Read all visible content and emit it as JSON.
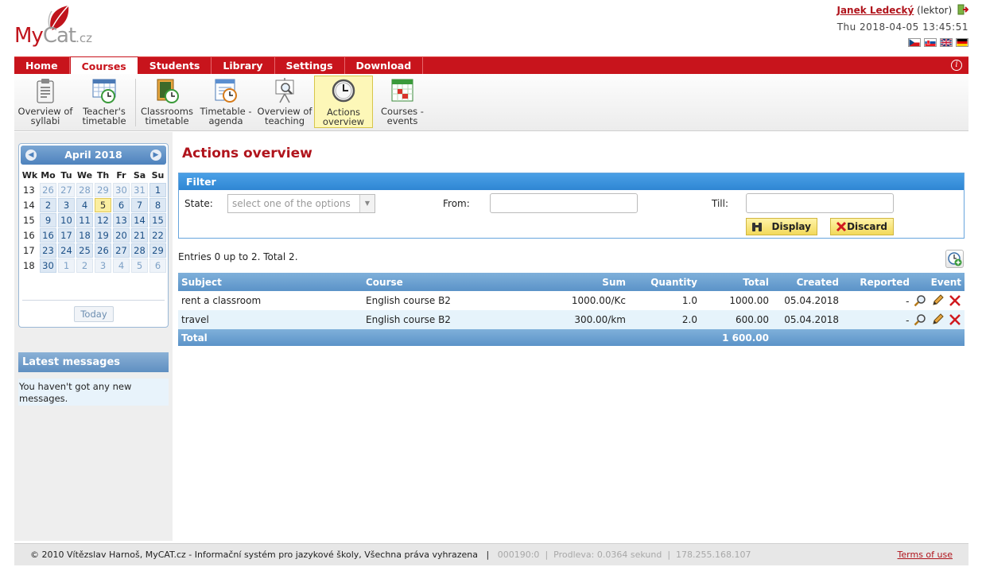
{
  "brand": {
    "logo_main": "My",
    "logo_cat": "Cat",
    "logo_tld": ".cz"
  },
  "user": {
    "name": "Janek Ledecký",
    "role": "(lektor)",
    "datetime": "Thu 2018-04-05 13:45:51"
  },
  "main_nav": [
    {
      "label": "Home",
      "active": false
    },
    {
      "label": "Courses",
      "active": true
    },
    {
      "label": "Students",
      "active": false
    },
    {
      "label": "Library",
      "active": false
    },
    {
      "label": "Settings",
      "active": false
    },
    {
      "label": "Download",
      "active": false
    }
  ],
  "sub_nav": [
    {
      "line1": "Overview of",
      "line2": "syllabi",
      "icon": "clipboard-icon",
      "active": false
    },
    {
      "line1": "Teacher's",
      "line2": "timetable",
      "icon": "calendar-clock-icon",
      "active": false
    },
    {
      "line1": "Classrooms",
      "line2": "timetable",
      "icon": "board-clock-icon",
      "active": false
    },
    {
      "line1": "Timetable -",
      "line2": "agenda",
      "icon": "agenda-clock-icon",
      "active": false
    },
    {
      "line1": "Overview of",
      "line2": "teaching",
      "icon": "easel-search-icon",
      "active": false
    },
    {
      "line1": "Actions",
      "line2": "overview",
      "icon": "clock-icon",
      "active": true
    },
    {
      "line1": "Courses -",
      "line2": "events",
      "icon": "events-calendar-icon",
      "active": false
    }
  ],
  "calendar": {
    "title": "April 2018",
    "headers": [
      "Wk",
      "Mo",
      "Tu",
      "We",
      "Th",
      "Fr",
      "Sa",
      "Su"
    ],
    "weeks": [
      {
        "wk": "13",
        "days": [
          "26",
          "27",
          "28",
          "29",
          "30",
          "31",
          "1"
        ]
      },
      {
        "wk": "14",
        "days": [
          "2",
          "3",
          "4",
          "5",
          "6",
          "7",
          "8"
        ]
      },
      {
        "wk": "15",
        "days": [
          "9",
          "10",
          "11",
          "12",
          "13",
          "14",
          "15"
        ]
      },
      {
        "wk": "16",
        "days": [
          "16",
          "17",
          "18",
          "19",
          "20",
          "21",
          "22"
        ]
      },
      {
        "wk": "17",
        "days": [
          "23",
          "24",
          "25",
          "26",
          "27",
          "28",
          "29"
        ]
      },
      {
        "wk": "18",
        "days": [
          "30",
          "1",
          "2",
          "3",
          "4",
          "5",
          "6"
        ]
      }
    ],
    "today_label": "Today"
  },
  "messages": {
    "title": "Latest messages",
    "body": "You haven't got any new messages."
  },
  "page": {
    "title": "Actions overview"
  },
  "filter": {
    "title": "Filter",
    "state_label": "State:",
    "state_placeholder": "select one of the options",
    "from_label": "From:",
    "till_label": "Till:",
    "display_label": "Display",
    "discard_label": "Discard"
  },
  "entries_text": "Entries 0 up to 2. Total 2.",
  "table": {
    "headers": [
      "Subject",
      "Course",
      "Sum",
      "Quantity",
      "Total",
      "Created",
      "Reported",
      "Event"
    ],
    "rows": [
      {
        "subject": "rent a classroom",
        "course": "English course B2",
        "sum": "1000.00/Kc",
        "quantity": "1.0",
        "total": "1000.00",
        "created": "05.04.2018",
        "reported": "-"
      },
      {
        "subject": "travel",
        "course": "English course B2",
        "sum": "300.00/km",
        "quantity": "2.0",
        "total": "600.00",
        "created": "05.04.2018",
        "reported": "-"
      }
    ],
    "total_label": "Total",
    "total_value": "1 600.00"
  },
  "footer": {
    "copyright": "© 2010 Vítězslav Harnoš, MyCAT.cz - Informační systém pro jazykové školy, Všechna práva vyhrazena",
    "sep": "|",
    "code": "000190:0",
    "timing": "Prodleva: 0.0364 sekund",
    "ip": "178.255.168.107",
    "terms": "Terms of use"
  },
  "colors": {
    "brand_red": "#c8141c",
    "filter_blue": "#2f86d3",
    "grid_blue": "#5b93c8",
    "highlight": "#fdf7b8"
  }
}
